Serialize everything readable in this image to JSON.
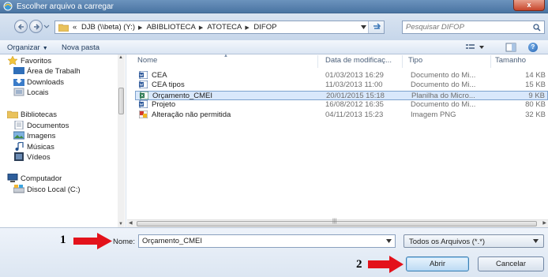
{
  "window": {
    "title": "Escolher arquivo a carregar",
    "close_label": "x"
  },
  "address": {
    "overflow_label": "«",
    "path": [
      "DJB (\\\\beta) (Y:)",
      "ABIBLIOTECA",
      "ATOTECA",
      "DIFOP"
    ],
    "search_placeholder": "Pesquisar DIFOP"
  },
  "toolbar": {
    "organize_label": "Organizar",
    "new_folder_label": "Nova pasta"
  },
  "nav": {
    "favorites_label": "Favoritos",
    "favorites": [
      "Área de Trabalh",
      "Downloads",
      "Locais"
    ],
    "libraries_label": "Bibliotecas",
    "libraries": [
      "Documentos",
      "Imagens",
      "Músicas",
      "Vídeos"
    ],
    "computer_label": "Computador",
    "drives": [
      "Disco Local (C:)"
    ]
  },
  "columns": {
    "name": "Nome",
    "date": "Data de modificaç...",
    "type": "Tipo",
    "size": "Tamanho"
  },
  "files": [
    {
      "name": "CEA",
      "date": "01/03/2013 16:29",
      "type": "Documento do Mi...",
      "size": "14 KB",
      "icon": "word-doc-icon"
    },
    {
      "name": "CEA tipos",
      "date": "11/03/2013 11:00",
      "type": "Documento do Mi...",
      "size": "15 KB",
      "icon": "word-doc-icon"
    },
    {
      "name": "Orçamento_CMEI",
      "date": "20/01/2015 15:18",
      "type": "Planilha do Micro...",
      "size": "9 KB",
      "icon": "excel-sheet-icon",
      "selected": true
    },
    {
      "name": "Projeto",
      "date": "16/08/2012 16:35",
      "type": "Documento do Mi...",
      "size": "80 KB",
      "icon": "word-doc-icon"
    },
    {
      "name": "Alteração não permitida",
      "date": "04/11/2013 15:23",
      "type": "Imagem PNG",
      "size": "32 KB",
      "icon": "png-image-icon"
    }
  ],
  "footer": {
    "name_label": "Nome:",
    "name_value": "Orçamento_CMEI",
    "filter_value": "Todos os Arquivos (*.*)",
    "open_label": "Abrir",
    "cancel_label": "Cancelar"
  },
  "annotations": {
    "step1": "1",
    "step2": "2"
  },
  "colors": {
    "annotation_arrow": "#e3121b",
    "selection": "#d9e8fb",
    "titlebar": "#4a74a2"
  }
}
